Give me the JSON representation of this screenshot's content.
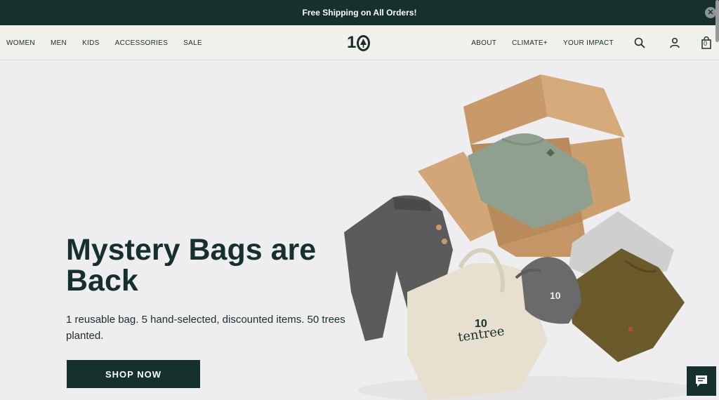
{
  "promo": {
    "text": "Free Shipping on All Orders!",
    "close_icon": "close-circle-icon"
  },
  "nav": {
    "left_links": [
      "WOMEN",
      "MEN",
      "KIDS",
      "ACCESSORIES",
      "SALE"
    ],
    "right_links": [
      "ABOUT",
      "CLIMATE+",
      "YOUR IMPACT"
    ],
    "logo_text": "10",
    "icons": [
      "search-icon",
      "account-icon",
      "cart-icon"
    ],
    "cart_count": "0"
  },
  "hero": {
    "title": "Mystery Bags are Back",
    "subtitle": "1 reusable bag. 5 hand-selected, discounted items. 50 trees planted.",
    "cta_label": "SHOP NOW",
    "tote_brand": "tentree",
    "tote_logo": "10"
  },
  "chat": {
    "icon": "chat-icon"
  },
  "colors": {
    "brand_dark": "#16302d",
    "nav_bg": "#f1f1ec",
    "hero_bg": "#eeeef0"
  }
}
